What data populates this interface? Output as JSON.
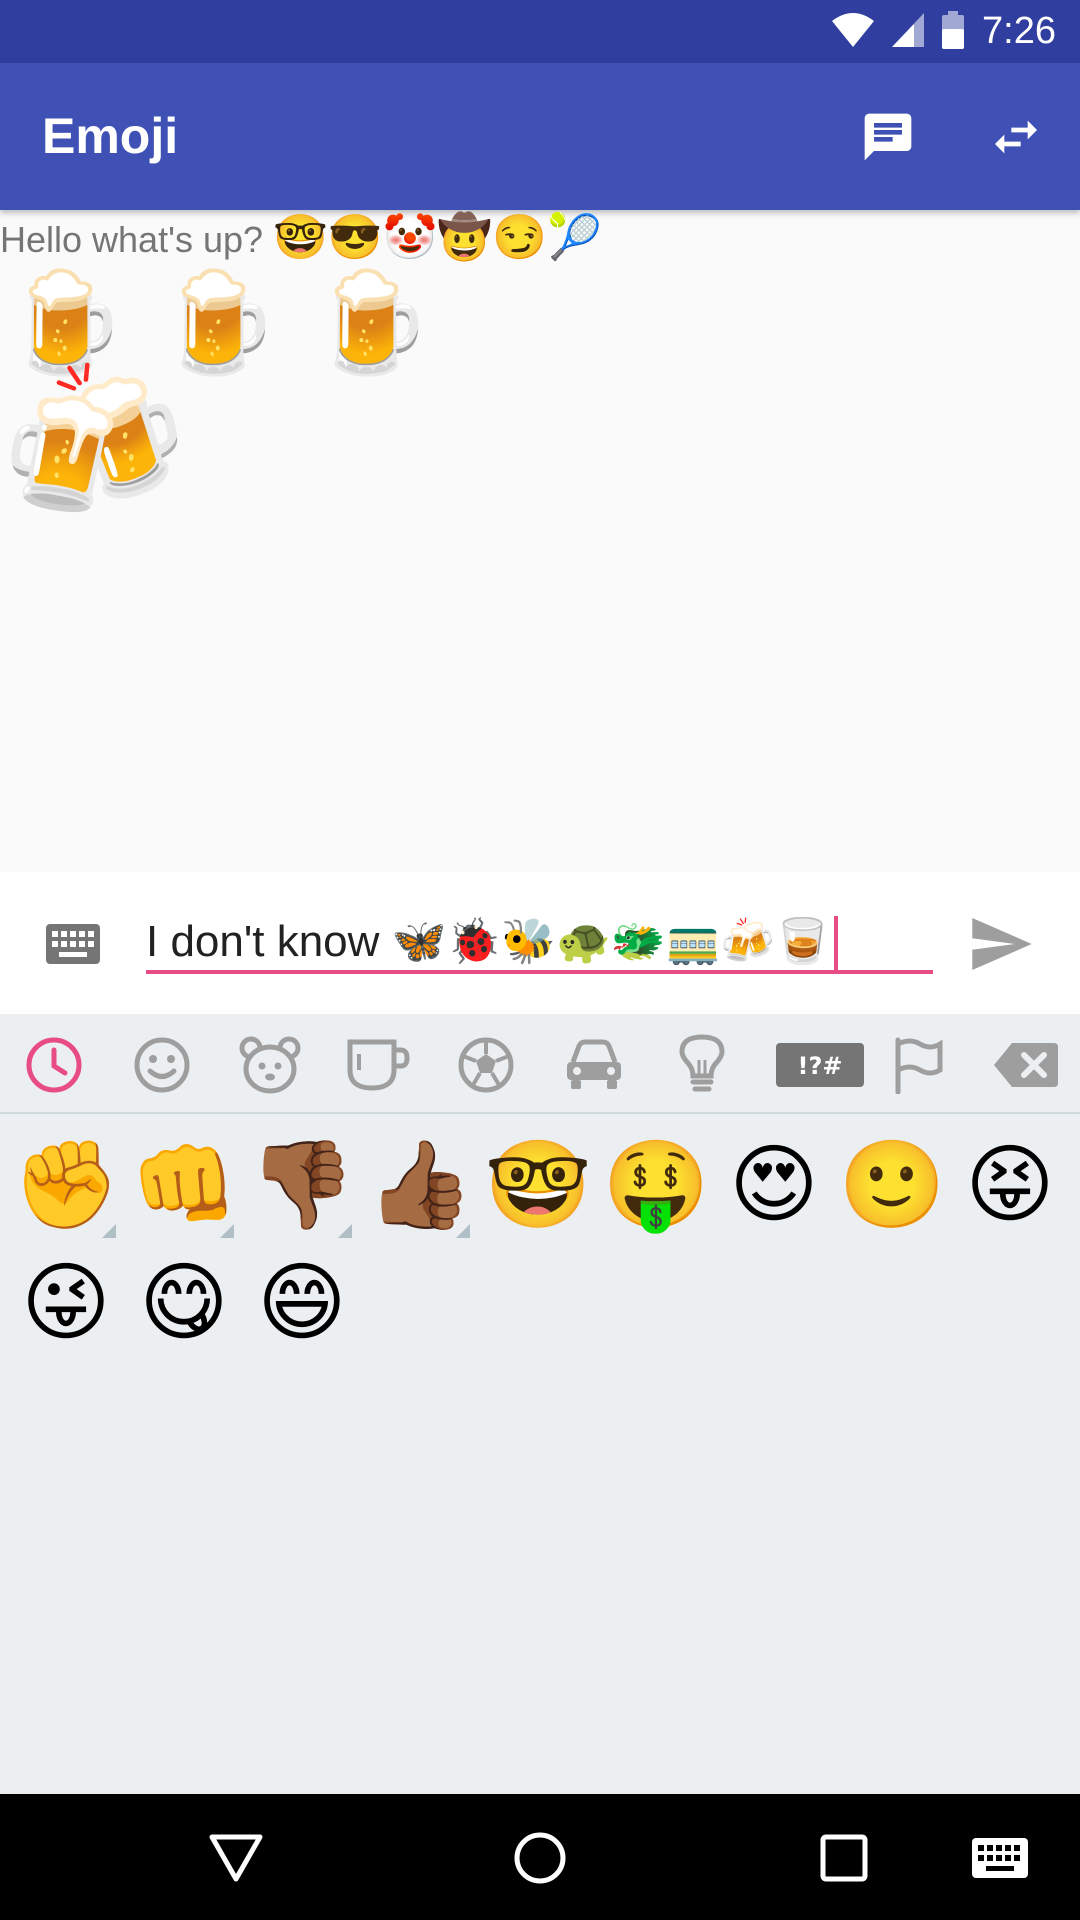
{
  "status_bar": {
    "time": "7:26"
  },
  "app_bar": {
    "title": "Emoji"
  },
  "messages": {
    "line1_text": "Hello what's up?",
    "line1_emoji": "🤓😎🤡🤠😏🎾",
    "line2_emoji": "🍺 🍺 🍺",
    "line3_emoji": "🍻"
  },
  "input": {
    "value": "I don't know 🦋🐞🐝🐢🐲🚃🍻🥃"
  },
  "emoji_tabs": [
    {
      "name": "recent",
      "active": true
    },
    {
      "name": "smileys"
    },
    {
      "name": "animals"
    },
    {
      "name": "food"
    },
    {
      "name": "activity"
    },
    {
      "name": "travel"
    },
    {
      "name": "objects"
    },
    {
      "name": "symbols",
      "label": "!?#"
    },
    {
      "name": "flags"
    },
    {
      "name": "backspace"
    }
  ],
  "recent_emoji": [
    "✊",
    "👊",
    "👎🏾",
    "👍🏾",
    "🤓",
    "🤑",
    "😍",
    "🙂",
    "😝",
    "😜",
    "😋",
    "😄"
  ],
  "colors": {
    "accent": "#e84c85",
    "primary": "#3f51b5",
    "primary_dark": "#303f9f"
  }
}
